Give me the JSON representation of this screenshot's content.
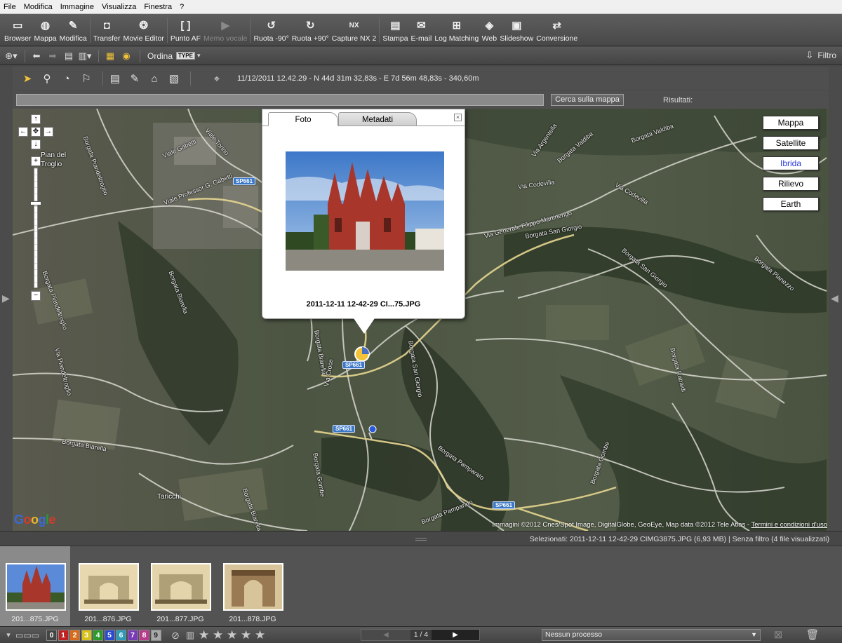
{
  "menu": [
    "File",
    "Modifica",
    "Immagine",
    "Visualizza",
    "Finestra",
    "?"
  ],
  "toolbar": [
    {
      "label": "Browser",
      "icon": "browser-icon",
      "glyph": "▭"
    },
    {
      "label": "Mappa",
      "icon": "globe-icon",
      "glyph": "◍"
    },
    {
      "label": "Modifica",
      "icon": "edit-icon",
      "glyph": "✎"
    },
    {
      "label": "Transfer",
      "icon": "camera-icon",
      "glyph": "◘"
    },
    {
      "label": "Movie Editor",
      "icon": "film-reel-icon",
      "glyph": "❂"
    },
    {
      "label": "Punto AF",
      "icon": "af-point-icon",
      "glyph": "[ ]"
    },
    {
      "label": "Memo vocale",
      "icon": "voice-memo-icon",
      "glyph": "▶",
      "disabled": true
    },
    {
      "label": "Ruota -90°",
      "icon": "rotate-left-icon",
      "glyph": "↺"
    },
    {
      "label": "Ruota +90°",
      "icon": "rotate-right-icon",
      "glyph": "↻"
    },
    {
      "label": "Capture NX 2",
      "icon": "capture-nx-icon",
      "glyph": "NX"
    },
    {
      "label": "Stampa",
      "icon": "print-icon",
      "glyph": "▤"
    },
    {
      "label": "E-mail",
      "icon": "email-icon",
      "glyph": "✉"
    },
    {
      "label": "Log Matching",
      "icon": "log-matching-icon",
      "glyph": "⊞"
    },
    {
      "label": "Web",
      "icon": "web-icon",
      "glyph": "◈"
    },
    {
      "label": "Slideshow",
      "icon": "slideshow-icon",
      "glyph": "▣"
    },
    {
      "label": "Conversione",
      "icon": "conversion-icon",
      "glyph": "⇄"
    }
  ],
  "bar2": {
    "ordina": "Ordina",
    "type_badge": "TYPE",
    "filtro": "Filtro"
  },
  "maptools": {
    "coords": "11/12/2011 12.42.29 - N 44d 31m 32,83s - E 7d 56m 48,83s - 340,60m"
  },
  "search": {
    "button": "Cerca sulla mappa",
    "results_label": "Risultati:",
    "value": ""
  },
  "map": {
    "types": [
      "Mappa",
      "Satellite",
      "Ibrida",
      "Rilievo",
      "Earth"
    ],
    "selected_type": "Ibrida",
    "roads": [
      "Borgata Piandeltroglio",
      "Viale Gabetti",
      "Viale Torino",
      "Viale Professor G. Gabetti",
      "Borgata Piandeltroglio",
      "Borgata Biarella",
      "Via Piandeltroglio",
      "Via Argentella",
      "Borgata Valdiba",
      "Borgata Valdiba",
      "Via Codevilla",
      "Via Codevilla",
      "Via Generale Filippo Martinengo",
      "Borgata San Giorgio",
      "Borgata San Giorgio",
      "Borgata Pianezzo",
      "Borgata San Giorgio",
      "Borgata Biarella",
      "Via Croce",
      "Borgata Gombe",
      "Borgata Pamparato",
      "Borgata Pamparato",
      "Borgata Gombe",
      "Borgata Biarella",
      "Borgata Rabaidi",
      "Borgata Biarella"
    ],
    "badges": [
      "SP661",
      "SP661",
      "SP661",
      "SP661"
    ],
    "places": [
      "Pian del Troglio",
      "Taricchi"
    ],
    "google": "Google",
    "copyright": "Immagini ©2012 Cnes/Spot Image, DigitalGlobe, GeoEye, Map data ©2012 Tele Atlas - ",
    "terms": "Termini e condizioni d'uso"
  },
  "popup": {
    "tab_foto": "Foto",
    "tab_metadati": "Metadati",
    "caption": "2011-12-11 12-42-29 CI...75.JPG"
  },
  "status": {
    "selected": "Selezionati: 2011-12-11 12-42-29 CIMG3875.JPG (6,93 MB) | Senza filtro  (4 file visualizzati)"
  },
  "thumbnails": [
    {
      "name": "201...875.JPG",
      "selected": true
    },
    {
      "name": "201...876.JPG",
      "selected": false
    },
    {
      "name": "201...877.JPG",
      "selected": false
    },
    {
      "name": "201...878.JPG",
      "selected": false
    }
  ],
  "bottom": {
    "labels": [
      "0",
      "1",
      "2",
      "3",
      "4",
      "5",
      "6",
      "7",
      "8",
      "9"
    ],
    "label_colors": [
      "#444",
      "#c02020",
      "#d86a1a",
      "#d8c21a",
      "#2a9a2a",
      "#2a4ad0",
      "#2a9ab8",
      "#7a3ab8",
      "#b83a8a",
      "#a8a8a8"
    ],
    "page": "1 / 4",
    "process": "Nessun processo",
    "stars": 5
  }
}
